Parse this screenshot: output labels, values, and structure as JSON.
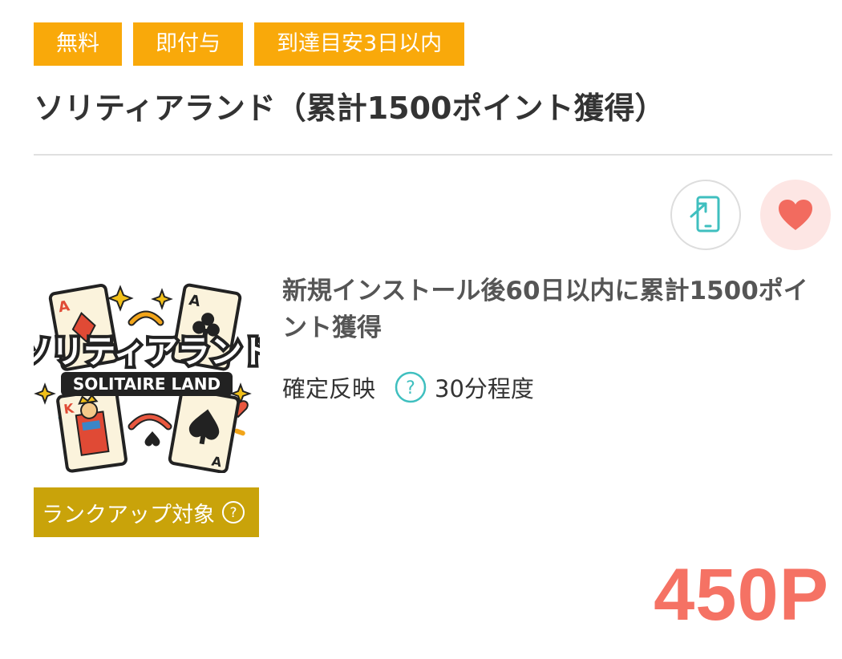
{
  "tags": [
    "無料",
    "即付与",
    "到達目安3日以内"
  ],
  "title": "ソリティアランド（累計1500ポイント獲得）",
  "actions": {
    "device_icon": "smartphone-arrow-icon",
    "favorite_icon": "heart-icon"
  },
  "app": {
    "logo_text_jp": "ソリティアランド",
    "logo_text_en": "SOLITAIRE LAND"
  },
  "offer": {
    "description": "新規インストール後60日以内に累計1500ポイント獲得",
    "confirm_label": "確定反映",
    "confirm_time": "30分程度"
  },
  "rank_badge": "ランクアップ対象",
  "points": "450P",
  "colors": {
    "tag": "#f9a90a",
    "rank_badge": "#c9a30a",
    "points": "#f57264",
    "teal_icon": "#3fbfbf",
    "heart": "#f26b5f"
  }
}
